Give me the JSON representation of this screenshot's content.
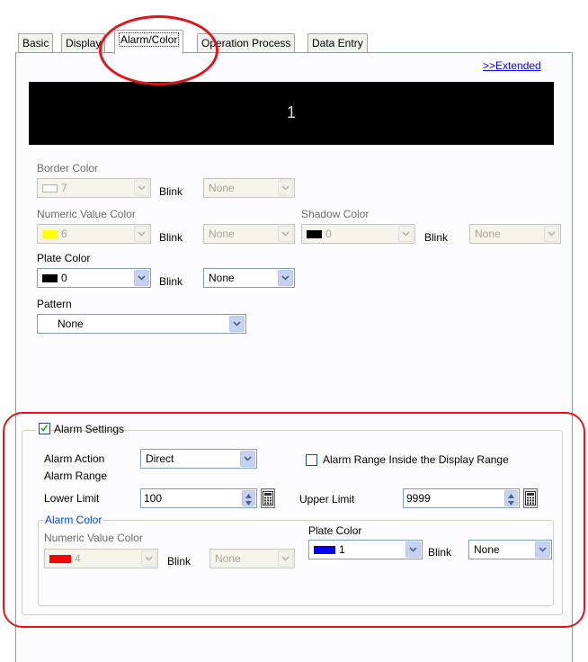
{
  "tabs": [
    {
      "label": "Basic"
    },
    {
      "label": "Display"
    },
    {
      "label": "Alarm/Color"
    },
    {
      "label": "Operation Process"
    },
    {
      "label": "Data Entry"
    }
  ],
  "extended_link": ">>Extended",
  "preview_value": "1",
  "border_color": {
    "label": "Border Color",
    "value": "7",
    "swatch": "#ffffff",
    "blink_label": "Blink",
    "blink_value": "None"
  },
  "numeric_value_color": {
    "label": "Numeric Value Color",
    "value": "6",
    "swatch": "#ffff00",
    "blink_label": "Blink",
    "blink_value": "None"
  },
  "shadow_color": {
    "label": "Shadow Color",
    "value": "0",
    "swatch": "#000000",
    "blink_label": "Blink",
    "blink_value": "None"
  },
  "plate_color": {
    "label": "Plate Color",
    "value": "0",
    "swatch": "#000000",
    "blink_label": "Blink",
    "blink_value": "None"
  },
  "pattern": {
    "label": "Pattern",
    "value": "None"
  },
  "alarm": {
    "settings_label": "Alarm Settings",
    "settings_checked": true,
    "action_label": "Alarm Action",
    "action_value": "Direct",
    "range_label": "Alarm Range",
    "inside_range_label": "Alarm Range Inside the Display Range",
    "inside_range_checked": false,
    "lower_label": "Lower Limit",
    "lower_value": "100",
    "upper_label": "Upper Limit",
    "upper_value": "9999",
    "color_group_label": "Alarm Color",
    "numeric_color": {
      "label": "Numeric Value Color",
      "value": "4",
      "swatch": "#ff0000",
      "blink_label": "Blink",
      "blink_value": "None"
    },
    "plate_color": {
      "label": "Plate Color",
      "value": "1",
      "swatch": "#0000ff",
      "blink_label": "Blink",
      "blink_value": "None"
    }
  },
  "colors": {
    "highlight": "#e0141c",
    "link": "#0000ee"
  }
}
